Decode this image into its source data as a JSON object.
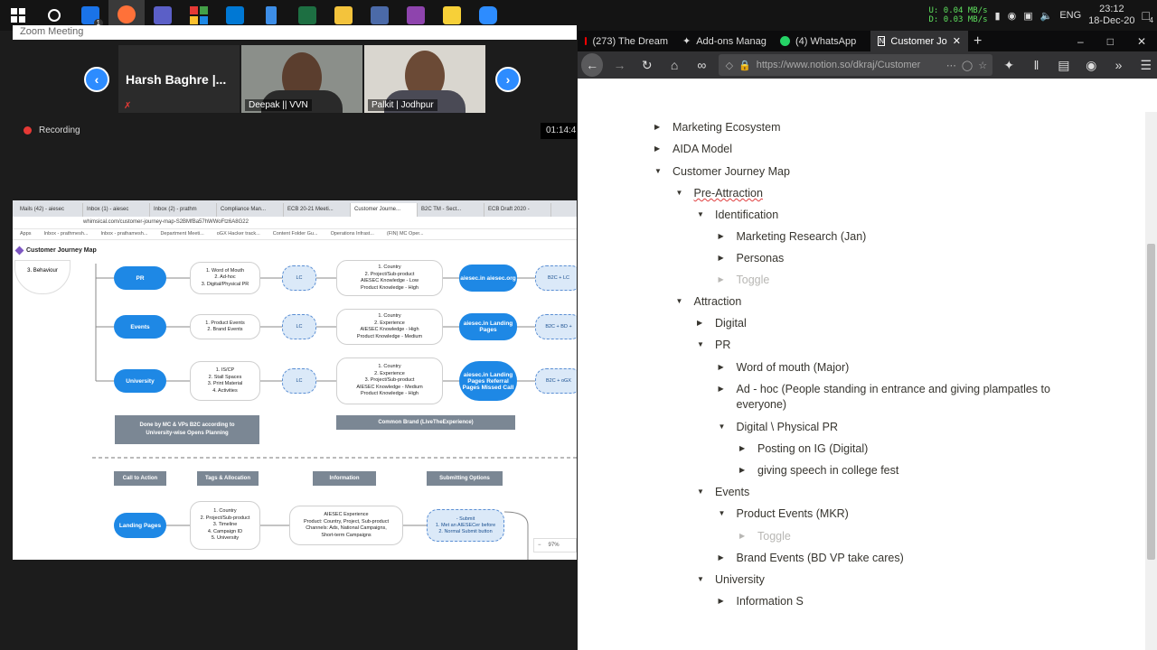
{
  "taskbar": {
    "apps": [
      "windows-start",
      "search",
      "mail",
      "firefox",
      "teams",
      "app-grid",
      "vscode",
      "phone",
      "excel",
      "explorer",
      "calculator",
      "screenshot",
      "sticky-notes",
      "zoom"
    ],
    "mail_badge": "1",
    "net_up": "U:   0.04 MB/s",
    "net_down": "D:   0.03 MB/s",
    "lang": "ENG",
    "time": "23:12",
    "date": "18-Dec-20",
    "notif_count": "4"
  },
  "zoom": {
    "window_title": "Zoom Meeting",
    "participants": [
      "Harsh Baghre |...",
      "Deepak || VVN",
      "Palkit | Jodhpur"
    ],
    "recording": "Recording",
    "timer": "01:14:4"
  },
  "shared_screen": {
    "tabs": [
      "Mails (42) - aiesec",
      "Inbox (1) - aiesec",
      "Inbox (2) - prathm",
      "Compliance Man...",
      "ECB 20-21 Meeti...",
      "Customer Journe...",
      "B2C TM - Sect...",
      "ECB Draft 2020 -"
    ],
    "url": "whimsical.com/customer-journey-map-S2BMfBa57hWWoFtz6A8G22",
    "bookmarks": [
      "Apps",
      "Inbox - prathmesh...",
      "Inbox - prathamesh...",
      "Department Meeti...",
      "oGX Hacker track...",
      "Content Folder Gu...",
      "Operations Infrast...",
      "(FIN) MC Oper..."
    ],
    "doc_title": "Customer Journey Map",
    "behaviour": "3. Behaviour",
    "rows": [
      {
        "pill": "PR",
        "items": "1. Word of Mouth\n2. Ad-hoc\n3. Digital/Physical PR",
        "lc": "LC",
        "know": "1. Country\n2. Project/Sub-product\nAIESEC Knowledge - Low\nProduct Knowledge - High",
        "dest": "aiesec.in\naiesec.org",
        "b2c": "B2C + LC"
      },
      {
        "pill": "Events",
        "items": "1. Product Events\n2. Brand Events",
        "lc": "LC",
        "know": "1. Country\n2. Experience\nAIESEC Knowledge - High\nProduct Knowledge - Medium",
        "dest": "aiesec.in\nLanding Pages",
        "b2c": "B2C + BD +"
      },
      {
        "pill": "University",
        "items": "1. IS/CP\n2. Stall Spaces\n3. Print Material\n4. Activities",
        "lc": "LC",
        "know": "1. Country\n2. Experience\n3. Project/Sub-product\nAIESEC Knowledge - Medium\nProduct Knowledge - High",
        "dest": "aiesec.in\nLanding Pages\nReferral Pages\nMissed Call",
        "b2c": "B2C + oGX"
      }
    ],
    "done_by": "Done by MC & VPs B2C according to\nUniversity-wise Opens Planning",
    "common_brand": "Common Brand (LiveTheExperience)",
    "headers": [
      "Call to Action",
      "Tags & Allocation",
      "Information",
      "Submitting Options"
    ],
    "landing": "Landing Pages",
    "tags": "1. Country\n2. Project/Sub-product\n3. Timeline\n4. Campaign ID\n5. University",
    "info": "AIESEC Experience\nProduct: Country, Project, Sub-product\nChannels: Ads, National Campaigns,\nShort-term Campaigns",
    "submit": "- Submit\n1. Met an AIESECer before\n2. Normal Submit button",
    "zoom_level": "97%"
  },
  "firefox": {
    "tabs": [
      "(273) The Dream",
      "Add-ons Manag",
      "(4) WhatsApp",
      "Customer Jo"
    ],
    "url": "https://www.notion.so/dkraj/Customer"
  },
  "notion": {
    "items": [
      {
        "text": "Marketing Ecosystem",
        "open": false,
        "faint": false
      },
      {
        "text": "AIDA Model",
        "open": false,
        "faint": false
      },
      {
        "text": "Customer Journey Map",
        "open": true,
        "faint": false
      },
      {
        "text": "Pre-Attraction",
        "open": true,
        "faint": false
      },
      {
        "text": "Identification",
        "open": true,
        "faint": false
      },
      {
        "text": "Marketing Research  (Jan)",
        "open": false,
        "faint": false
      },
      {
        "text": "Personas",
        "open": false,
        "faint": false
      },
      {
        "text": "Toggle",
        "open": false,
        "faint": true
      },
      {
        "text": "Attraction",
        "open": true,
        "faint": false
      },
      {
        "text": "Digital",
        "open": false,
        "faint": false
      },
      {
        "text": "PR",
        "open": true,
        "faint": false
      },
      {
        "text": "Word of mouth (Major)",
        "open": false,
        "faint": false
      },
      {
        "text": "Ad - hoc (People standing in entrance and giving plampatles to",
        "open": false,
        "faint": false
      },
      {
        "text": "everyone)",
        "open": false,
        "faint": false
      },
      {
        "text": "Digital \\ Physical PR",
        "open": true,
        "faint": false
      },
      {
        "text": "Posting on IG (Digital)",
        "open": false,
        "faint": false
      },
      {
        "text": "giving speech in college fest",
        "open": false,
        "faint": false
      },
      {
        "text": "Events",
        "open": true,
        "faint": false
      },
      {
        "text": "Product Events (MKR)",
        "open": true,
        "faint": false
      },
      {
        "text": "Toggle",
        "open": false,
        "faint": true
      },
      {
        "text": "Brand Events  (BD VP take cares)",
        "open": false,
        "faint": false
      },
      {
        "text": "University",
        "open": true,
        "faint": false
      },
      {
        "text": "Information S",
        "open": false,
        "faint": false
      }
    ]
  },
  "colors": {
    "accent": "#2d8cff",
    "pill": "#1e88e5",
    "notion_text": "#37352f"
  }
}
